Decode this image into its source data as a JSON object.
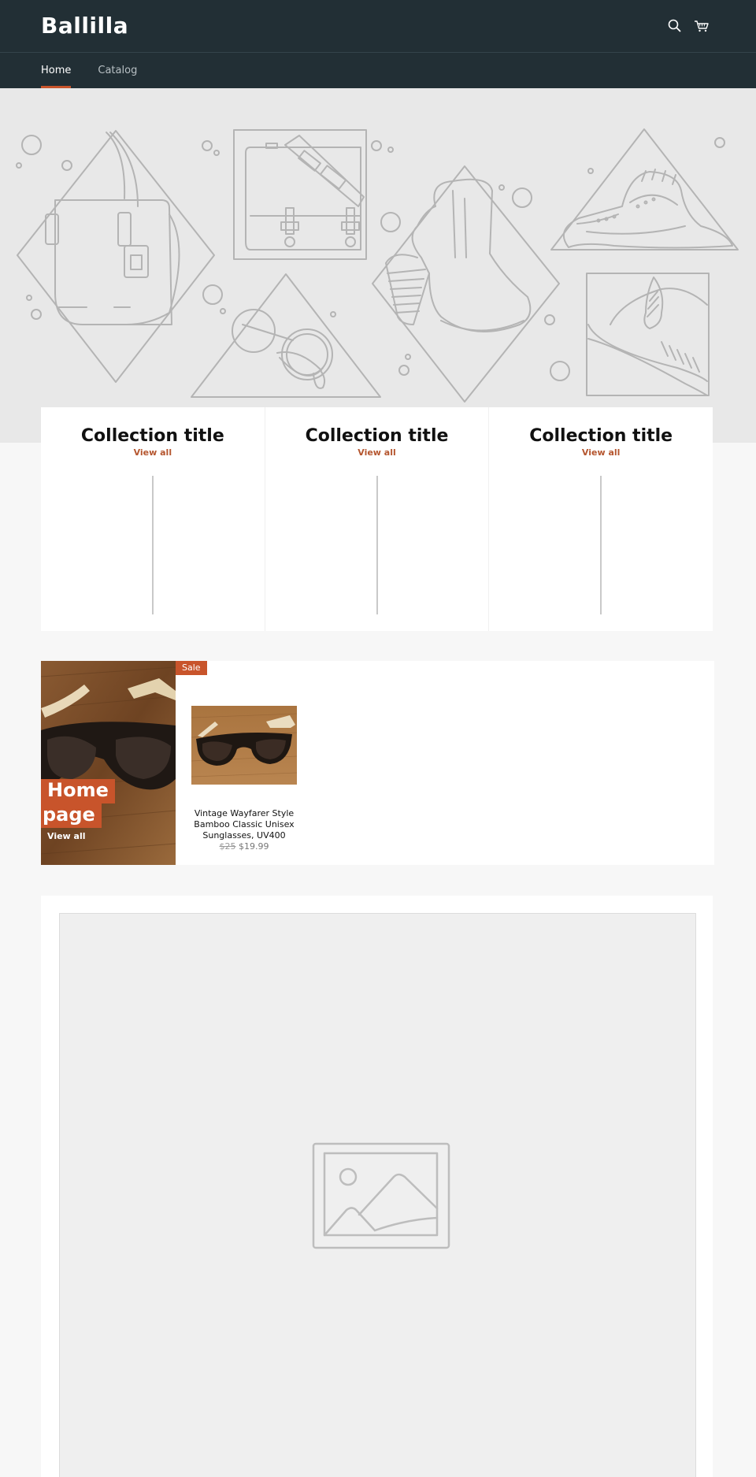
{
  "header": {
    "logo": "Ballilla",
    "icons": [
      "search-icon",
      "cart-icon"
    ],
    "nav": [
      {
        "label": "Home",
        "active": true
      },
      {
        "label": "Catalog",
        "active": false
      }
    ]
  },
  "collections": [
    {
      "title": "Collection title",
      "link": "View all"
    },
    {
      "title": "Collection title",
      "link": "View all"
    },
    {
      "title": "Collection title",
      "link": "View all"
    }
  ],
  "featured": {
    "title_line1": "Home",
    "title_line2": "page",
    "view_all": "View all",
    "badge": "Sale",
    "product": {
      "title": "Vintage Wayfarer Style Bamboo Classic Unisex Sunglasses, UV400",
      "compare_price": "$25",
      "price": "$19.99"
    }
  },
  "colors": {
    "header_bg": "#222f35",
    "accent": "#c8542b",
    "link": "#b5562f",
    "page_bg": "#f7f7f7"
  }
}
